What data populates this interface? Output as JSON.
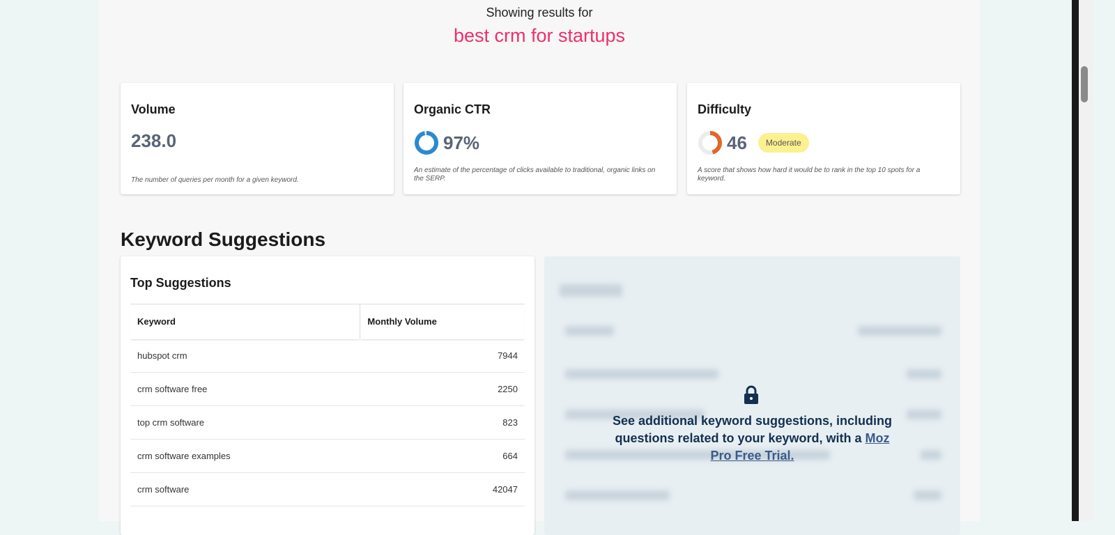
{
  "header": {
    "showing": "Showing results for",
    "query": "best crm for startups"
  },
  "metrics": [
    {
      "title": "Volume",
      "value": "238.0",
      "desc": "The number of queries per month for a given keyword."
    },
    {
      "title": "Organic CTR",
      "value": "97%",
      "percent": 97,
      "desc": "An estimate of the percentage of clicks available to traditional, organic links on the SERP."
    },
    {
      "title": "Difficulty",
      "value": "46",
      "score": 46,
      "badge": "Moderate",
      "desc": "A score that shows how hard it would be to rank in the top 10 spots for a keyword."
    }
  ],
  "section_title": "Keyword Suggestions",
  "top": {
    "title": "Top Suggestions",
    "columns": [
      "Keyword",
      "Monthly Volume"
    ],
    "rows": [
      [
        "hubspot crm",
        "7944"
      ],
      [
        "crm software free",
        "2250"
      ],
      [
        "top crm software",
        "823"
      ],
      [
        "crm software examples",
        "664"
      ],
      [
        "crm software",
        "42047"
      ]
    ]
  },
  "locked": {
    "text": "See additional keyword suggestions, including questions related to your keyword, with a ",
    "link": "Moz Pro Free Trial."
  },
  "colors": {
    "accent": "#ee2f6b",
    "ctr": "#2a8ad0",
    "difficulty": "#e0672a"
  }
}
